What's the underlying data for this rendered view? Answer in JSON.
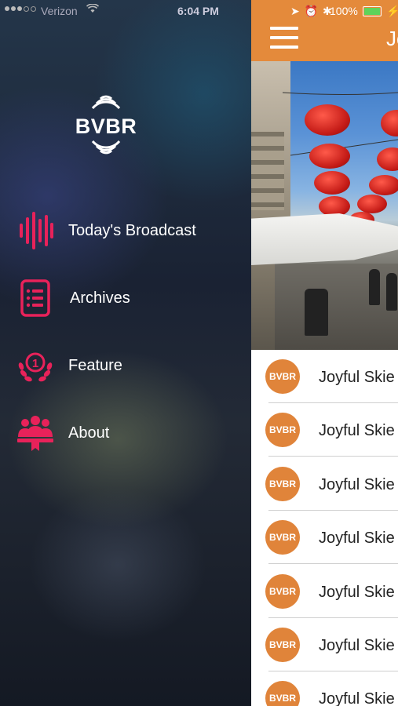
{
  "status_bar": {
    "carrier": "Verizon",
    "time": "6:04 PM",
    "battery_percent": "100%"
  },
  "drawer": {
    "logo_text": "BVBR",
    "menu": [
      {
        "label": "Today's Broadcast",
        "icon": "soundwave-icon"
      },
      {
        "label": "Archives",
        "icon": "document-list-icon"
      },
      {
        "label": "Feature",
        "icon": "laurel-number-one-icon"
      },
      {
        "label": "About",
        "icon": "group-people-icon"
      }
    ]
  },
  "main": {
    "nav_title": "Jo",
    "list": [
      {
        "avatar_text": "BVBR",
        "title": "Joyful Skie"
      },
      {
        "avatar_text": "BVBR",
        "title": "Joyful Skie"
      },
      {
        "avatar_text": "BVBR",
        "title": "Joyful Skie"
      },
      {
        "avatar_text": "BVBR",
        "title": "Joyful Skie"
      },
      {
        "avatar_text": "BVBR",
        "title": "Joyful Skie"
      },
      {
        "avatar_text": "BVBR",
        "title": "Joyful Skie"
      },
      {
        "avatar_text": "BVBR",
        "title": "Joyful Skie"
      }
    ]
  },
  "colors": {
    "accent": "#e48a3b",
    "menu_icon": "#e8225a"
  }
}
